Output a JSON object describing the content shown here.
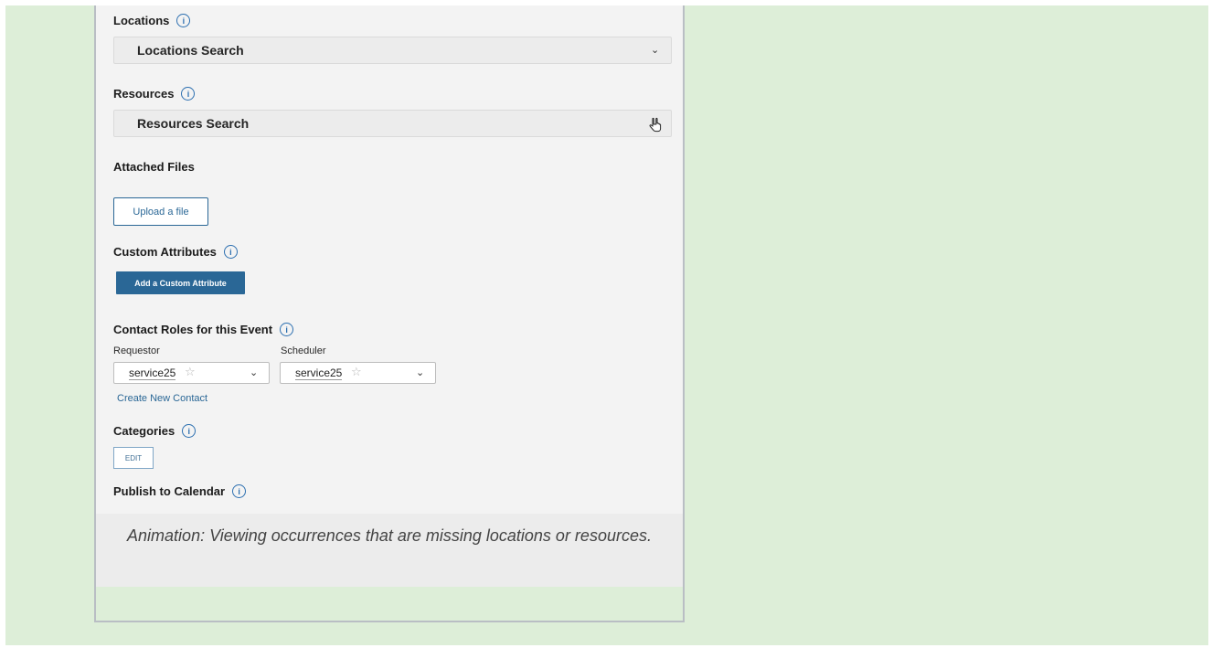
{
  "locations": {
    "label": "Locations",
    "search_text": "Locations Search"
  },
  "resources": {
    "label": "Resources",
    "search_text": "Resources Search"
  },
  "attached_files": {
    "label": "Attached Files",
    "upload_label": "Upload a file"
  },
  "custom_attributes": {
    "label": "Custom Attributes",
    "add_label": "Add a Custom Attribute"
  },
  "contact_roles": {
    "label": "Contact Roles for this Event",
    "requestor_label": "Requestor",
    "requestor_value": "service25",
    "scheduler_label": "Scheduler",
    "scheduler_value": "service25",
    "create_contact_label": "Create New Contact"
  },
  "categories": {
    "label": "Categories",
    "edit_label": "EDIT"
  },
  "publish": {
    "label": "Publish to Calendar"
  },
  "caption": "Animation: Viewing occurrences that are missing locations or resources.",
  "icons": {
    "info": "info-icon",
    "chevron": "chevron-down-icon",
    "star": "star-outline-icon",
    "cursor": "hand-pointer-cursor"
  },
  "colors": {
    "accent": "#2a6796",
    "page_background": "#ddeed8",
    "panel_background": "#f3f3f3"
  }
}
